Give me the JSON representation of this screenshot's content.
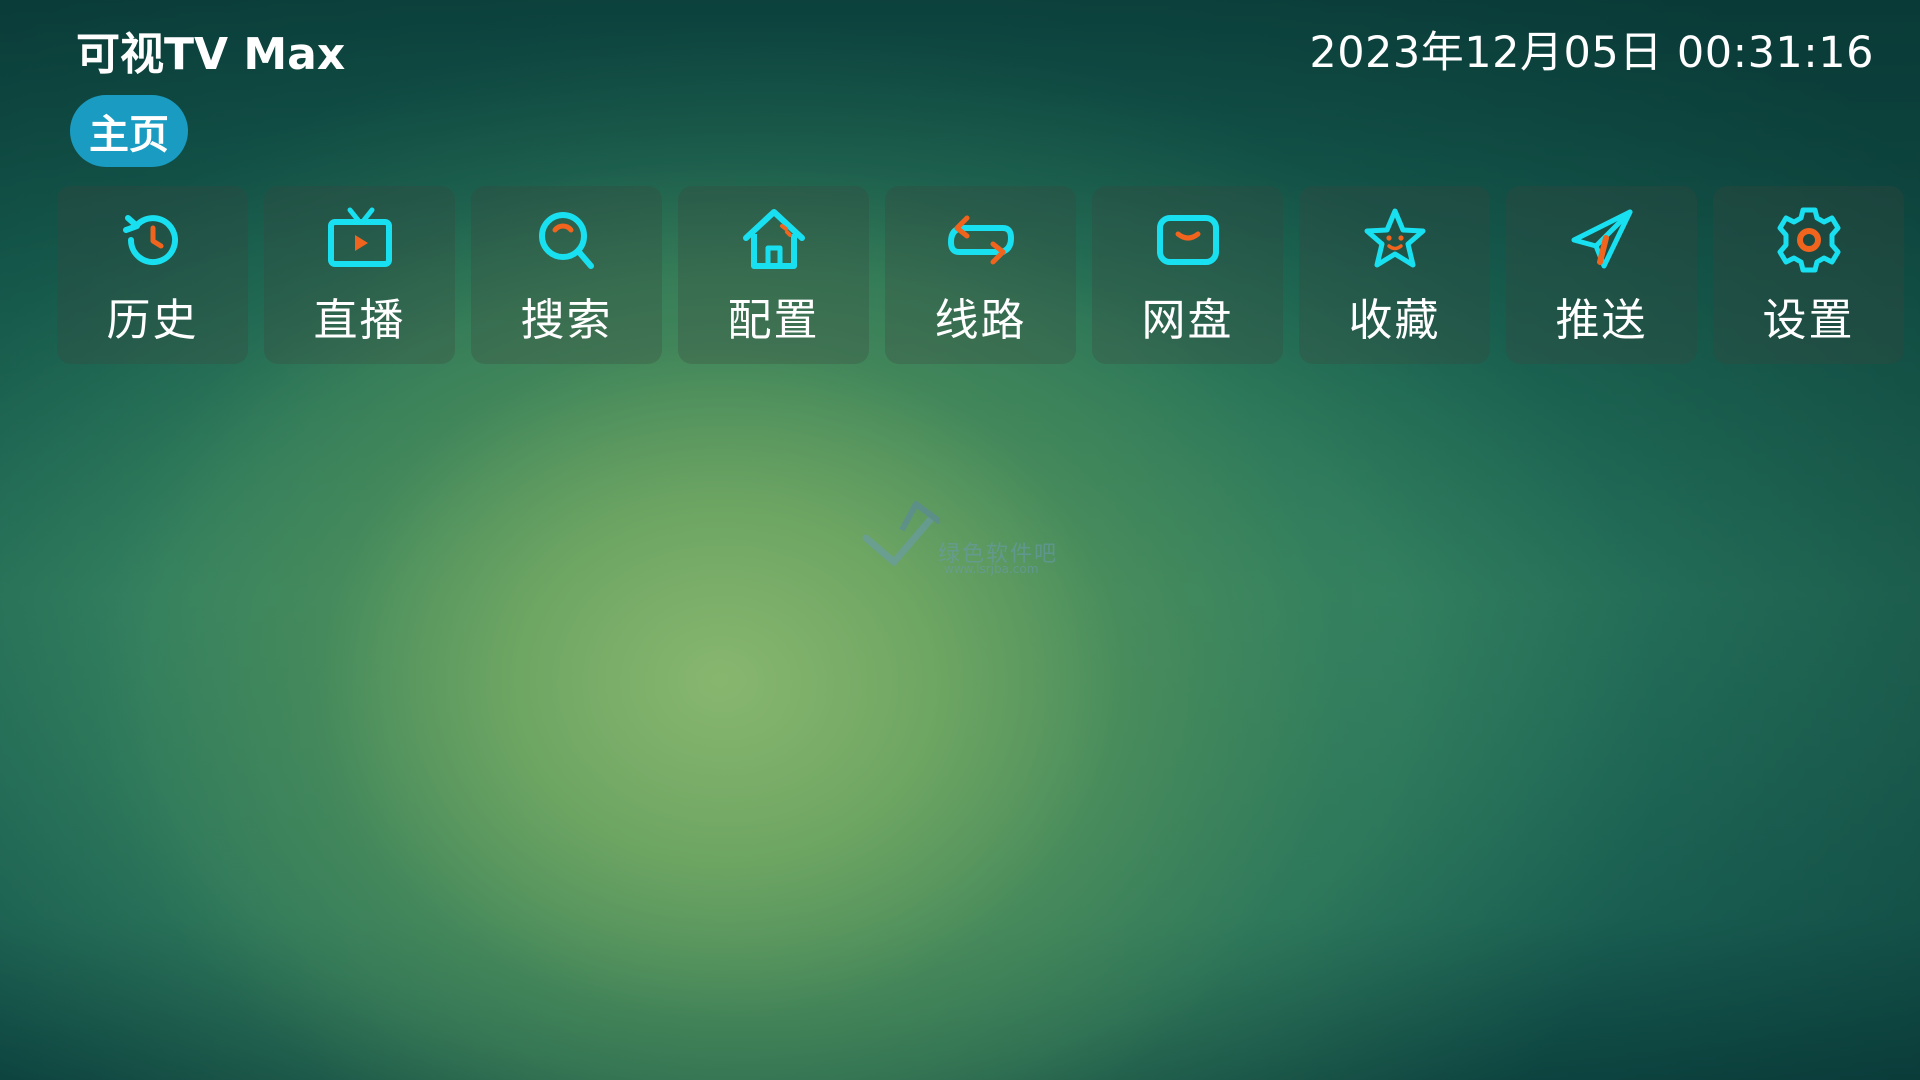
{
  "header": {
    "app_title": "可视TV Max",
    "datetime": "2023年12月05日 00:31:16"
  },
  "tabs": [
    {
      "label": "主页",
      "active": true
    }
  ],
  "menu": {
    "items": [
      {
        "label": "历史",
        "icon": "history-icon"
      },
      {
        "label": "直播",
        "icon": "tv-icon"
      },
      {
        "label": "搜索",
        "icon": "search-icon"
      },
      {
        "label": "配置",
        "icon": "home-icon"
      },
      {
        "label": "线路",
        "icon": "switch-route-icon"
      },
      {
        "label": "网盘",
        "icon": "cloud-drive-icon"
      },
      {
        "label": "收藏",
        "icon": "star-icon"
      },
      {
        "label": "推送",
        "icon": "send-icon"
      },
      {
        "label": "设置",
        "icon": "gear-icon"
      }
    ]
  },
  "watermark": {
    "text": "绿色软件吧",
    "url": "www.lsrjba.com"
  },
  "colors": {
    "icon_primary": "#19e0f0",
    "icon_accent": "#f0641e",
    "tab_active_bg": "#1a9bc1",
    "text": "#ffffff"
  }
}
